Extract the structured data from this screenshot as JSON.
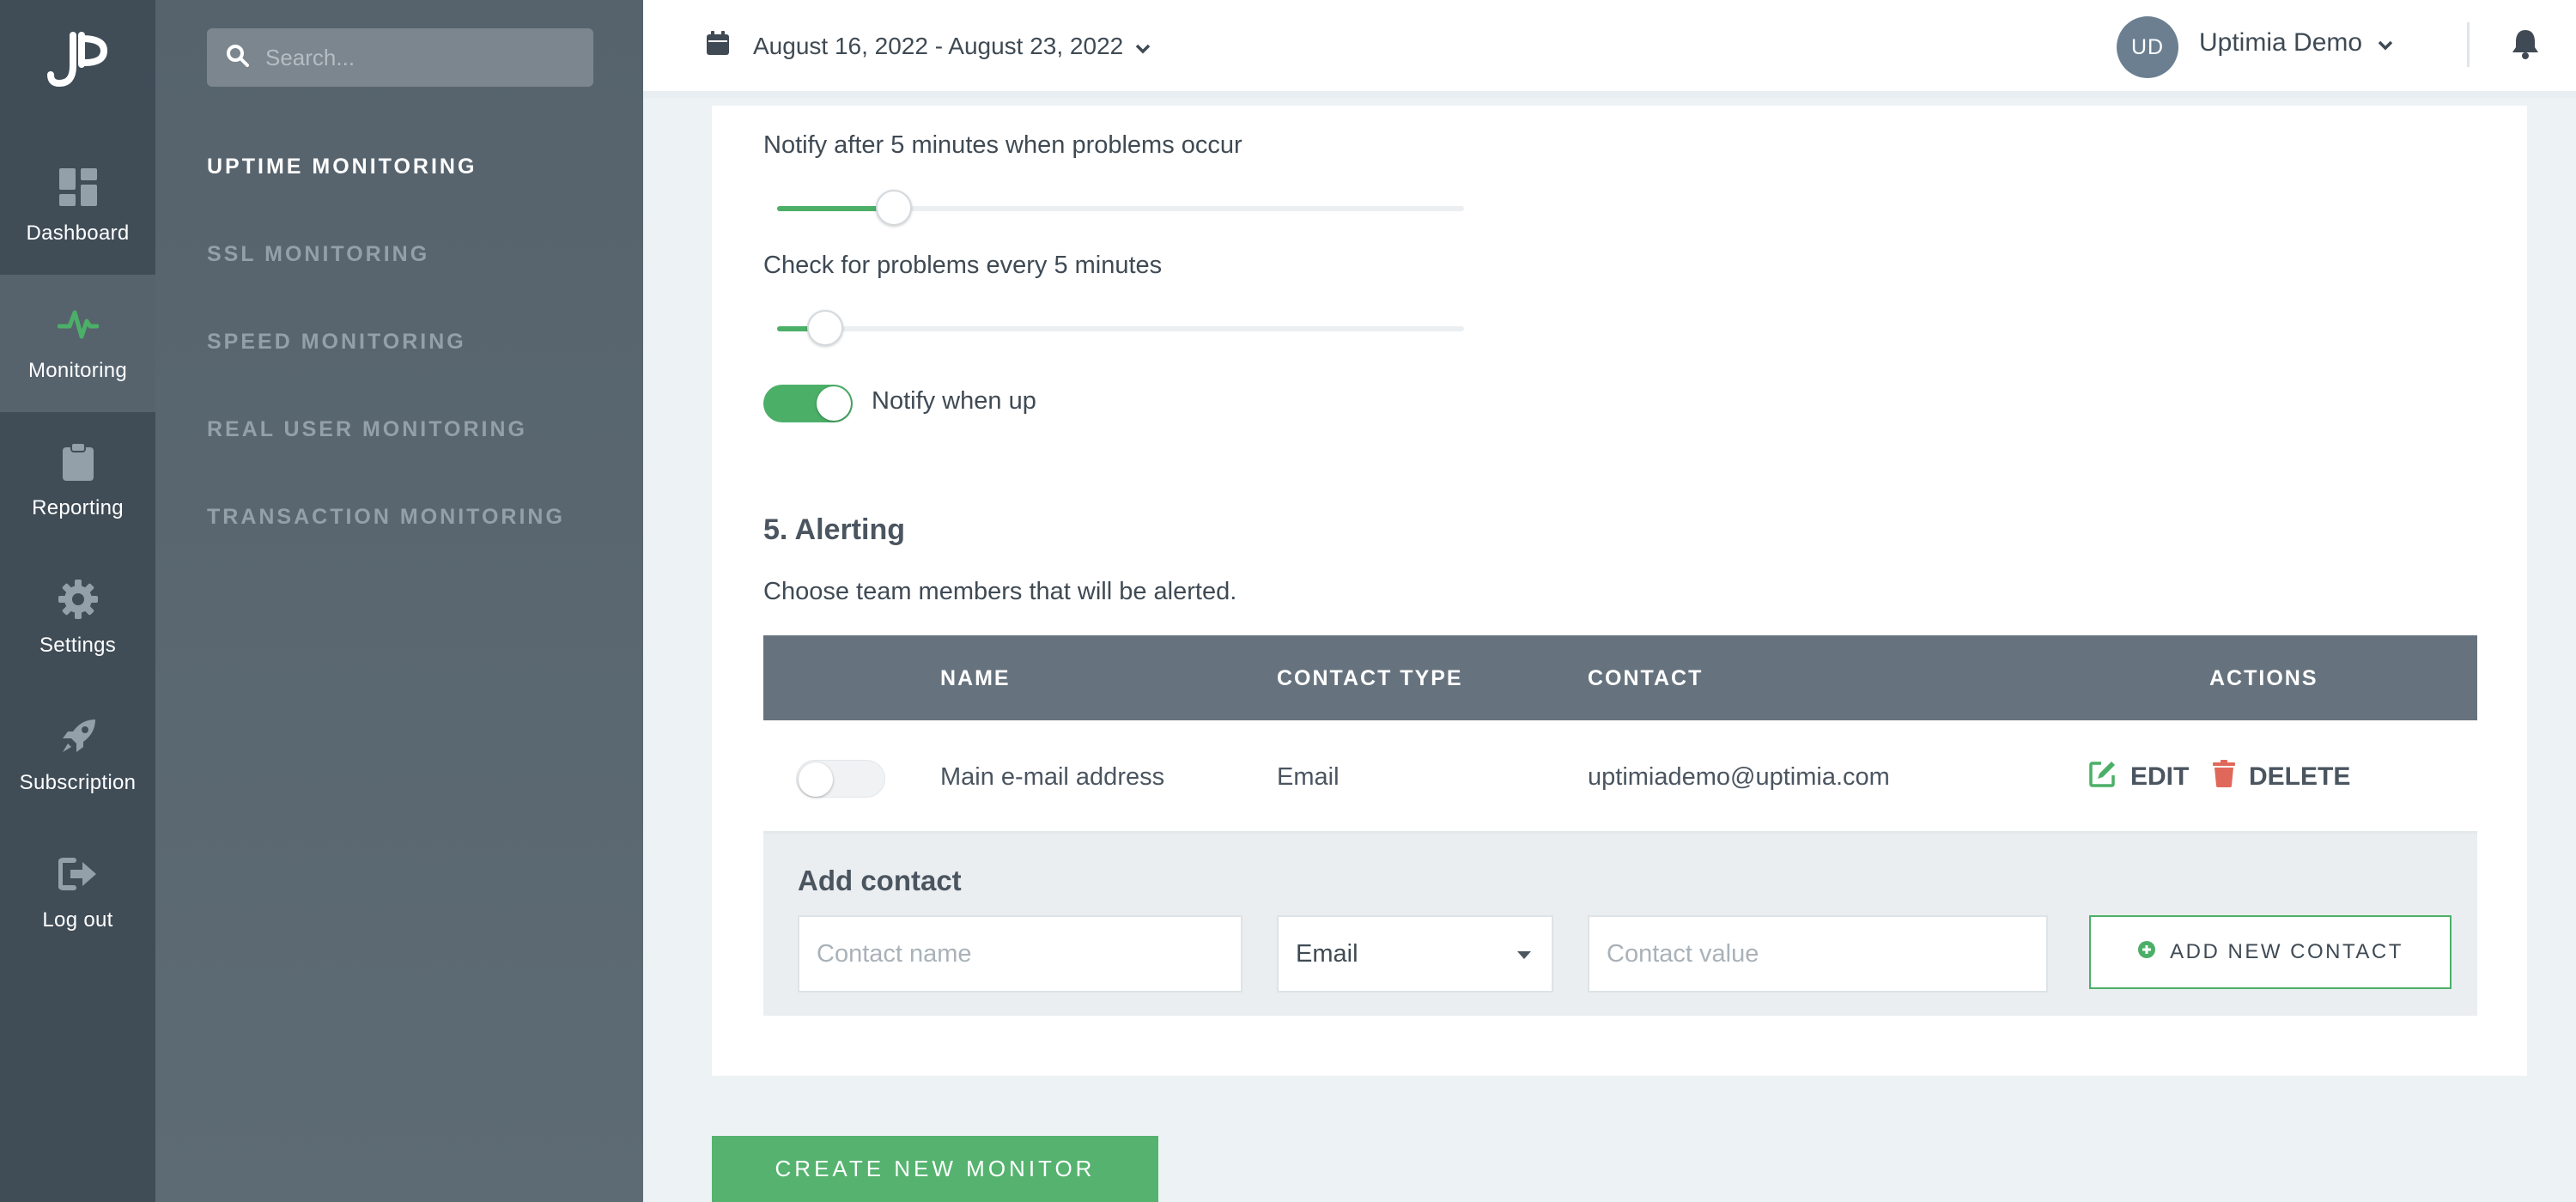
{
  "rail": {
    "items": [
      {
        "label": "Dashboard",
        "icon": "dashboard-icon"
      },
      {
        "label": "Monitoring",
        "icon": "pulse-icon",
        "active": true
      },
      {
        "label": "Reporting",
        "icon": "clipboard-icon"
      },
      {
        "label": "Settings",
        "icon": "gear-icon"
      },
      {
        "label": "Subscription",
        "icon": "rocket-icon"
      },
      {
        "label": "Log out",
        "icon": "logout-icon"
      }
    ]
  },
  "sidebar": {
    "search_placeholder": "Search...",
    "links": [
      {
        "label": "UPTIME MONITORING",
        "active": true
      },
      {
        "label": "SSL MONITORING"
      },
      {
        "label": "SPEED MONITORING"
      },
      {
        "label": "REAL USER MONITORING"
      },
      {
        "label": "TRANSACTION MONITORING"
      }
    ]
  },
  "topbar": {
    "date_range": "August 16, 2022 - August 23, 2022",
    "avatar_initials": "UD",
    "user_name": "Uptimia Demo"
  },
  "settings": {
    "notify_after_label": "Notify after 5 minutes when problems occur",
    "notify_after_level": 0.17,
    "check_every_label": "Check for problems every 5 minutes",
    "check_every_level": 0.07,
    "notify_when_up_label": "Notify when up",
    "notify_when_up": true
  },
  "alerting": {
    "title": "5. Alerting",
    "subtitle": "Choose team members that will be alerted.",
    "columns": [
      "NAME",
      "CONTACT TYPE",
      "CONTACT",
      "ACTIONS"
    ],
    "rows": [
      {
        "name": "Main e-mail address",
        "type": "Email",
        "contact": "uptimiademo@uptimia.com",
        "enabled": false
      }
    ],
    "edit_label": "EDIT",
    "delete_label": "DELETE",
    "add": {
      "title": "Add contact",
      "name_placeholder": "Contact name",
      "type_value": "Email",
      "value_placeholder": "Contact value",
      "button_label": "ADD NEW CONTACT"
    }
  },
  "create_button_label": "CREATE NEW MONITOR",
  "colors": {
    "accent": "#4caf68",
    "rail": "#404d57",
    "sidebar": "#5a6771",
    "table_header": "#66737e",
    "delete": "#e0685a"
  }
}
